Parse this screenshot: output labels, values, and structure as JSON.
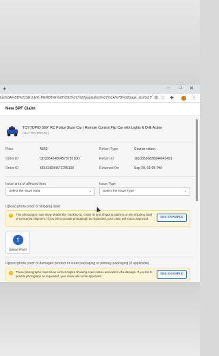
{
  "browser": {
    "url": "tus%3A%5B%22SELLER_PENDING%22%5D%2C%22pagination%22%3A%7B%22page_size%22%3A10%2C%22starting_page...",
    "new_tab": "+",
    "window_controls": [
      "–",
      "□",
      "✕"
    ]
  },
  "modal": {
    "title": "New SPF Claim"
  },
  "product": {
    "title": "TOYTOPIO 360° RC Police Stunt Car | Remote Control Flip Car with Lights & Drift Action",
    "sku": "(sku: TOYTOPIO4)"
  },
  "details": {
    "price_label": "Price",
    "price_value": "₹663",
    "order_id_label": "Order ID",
    "order_id_value": "OD33542400457375510O",
    "order_item_label": "Order ID",
    "order_item_value": "335424004573755100",
    "return_type_label": "Return Type",
    "return_type_value": "Courier return",
    "return_id_label": "Return ID",
    "return_id_value": "10103550836044643491",
    "returned_on_label": "Returned On",
    "returned_on_value": "Sep 29, 01:05 PM"
  },
  "form": {
    "issue_area_label": "Issue area of affected item",
    "issue_area_placeholder": "Select the Issue Area",
    "issue_type_label": "Issue Type",
    "issue_type_placeholder": "Select the Issue Type",
    "shipping_label_title": "Upload photo proof of shipping label",
    "shipping_note": "This photograph must show details like Tracking ID, Order ID and Shipping address on the shipping label of a returned shipment. If you fail to provide photograph as requested, your claim will not be approved.",
    "see_example": "SEE EXAMPLE",
    "upload_photo": "Upload Photo",
    "damaged_title": "Upload photo proof of damaged product or outer packaging or primary packaging (if applicable)",
    "damaged_note": "These photographs must show correct angles showing exact nature and extent of a damage. If you fail to provide photograph as requested, your claim will not be approved.",
    "see_example_2": "SEE EXAMPLE"
  },
  "colors": {
    "accent": "#2862c4",
    "note_bg": "#fdf5d8",
    "note_icon": "#f0b400"
  }
}
